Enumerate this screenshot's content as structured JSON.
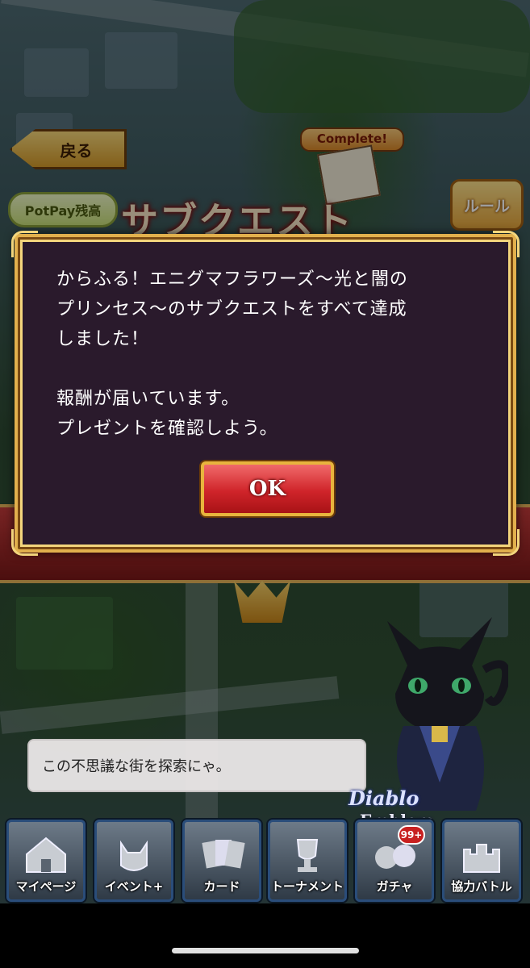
{
  "header": {
    "back_label": "戻る",
    "potpay_label": "PotPay残高",
    "rule_label": "ルール",
    "title": "サブクエスト",
    "complete_label": "Complete!"
  },
  "dialog": {
    "message": "からふる！エニグマフラワーズ〜光と闇の\nプリンセス〜のサブクエストをすべて達成\nしました！\n\n報酬が届いています。\nプレゼントを確認しよう。",
    "ok_label": "OK"
  },
  "speech": {
    "text": "この不思議な街を探索にゃ。"
  },
  "logo": {
    "line1": "Diablo",
    "line2": "Emblem"
  },
  "nav": {
    "items": [
      {
        "label": "マイページ"
      },
      {
        "label": "イベント+"
      },
      {
        "label": "カード"
      },
      {
        "label": "トーナメント"
      },
      {
        "label": "ガチャ",
        "badge": "99+"
      },
      {
        "label": "協力バトル"
      }
    ]
  },
  "colors": {
    "dialog_bg": "#2a1a2c",
    "gold_border": "#e2b04d",
    "ok_red": "#d0242a",
    "nav_border": "#2a4d7a"
  }
}
